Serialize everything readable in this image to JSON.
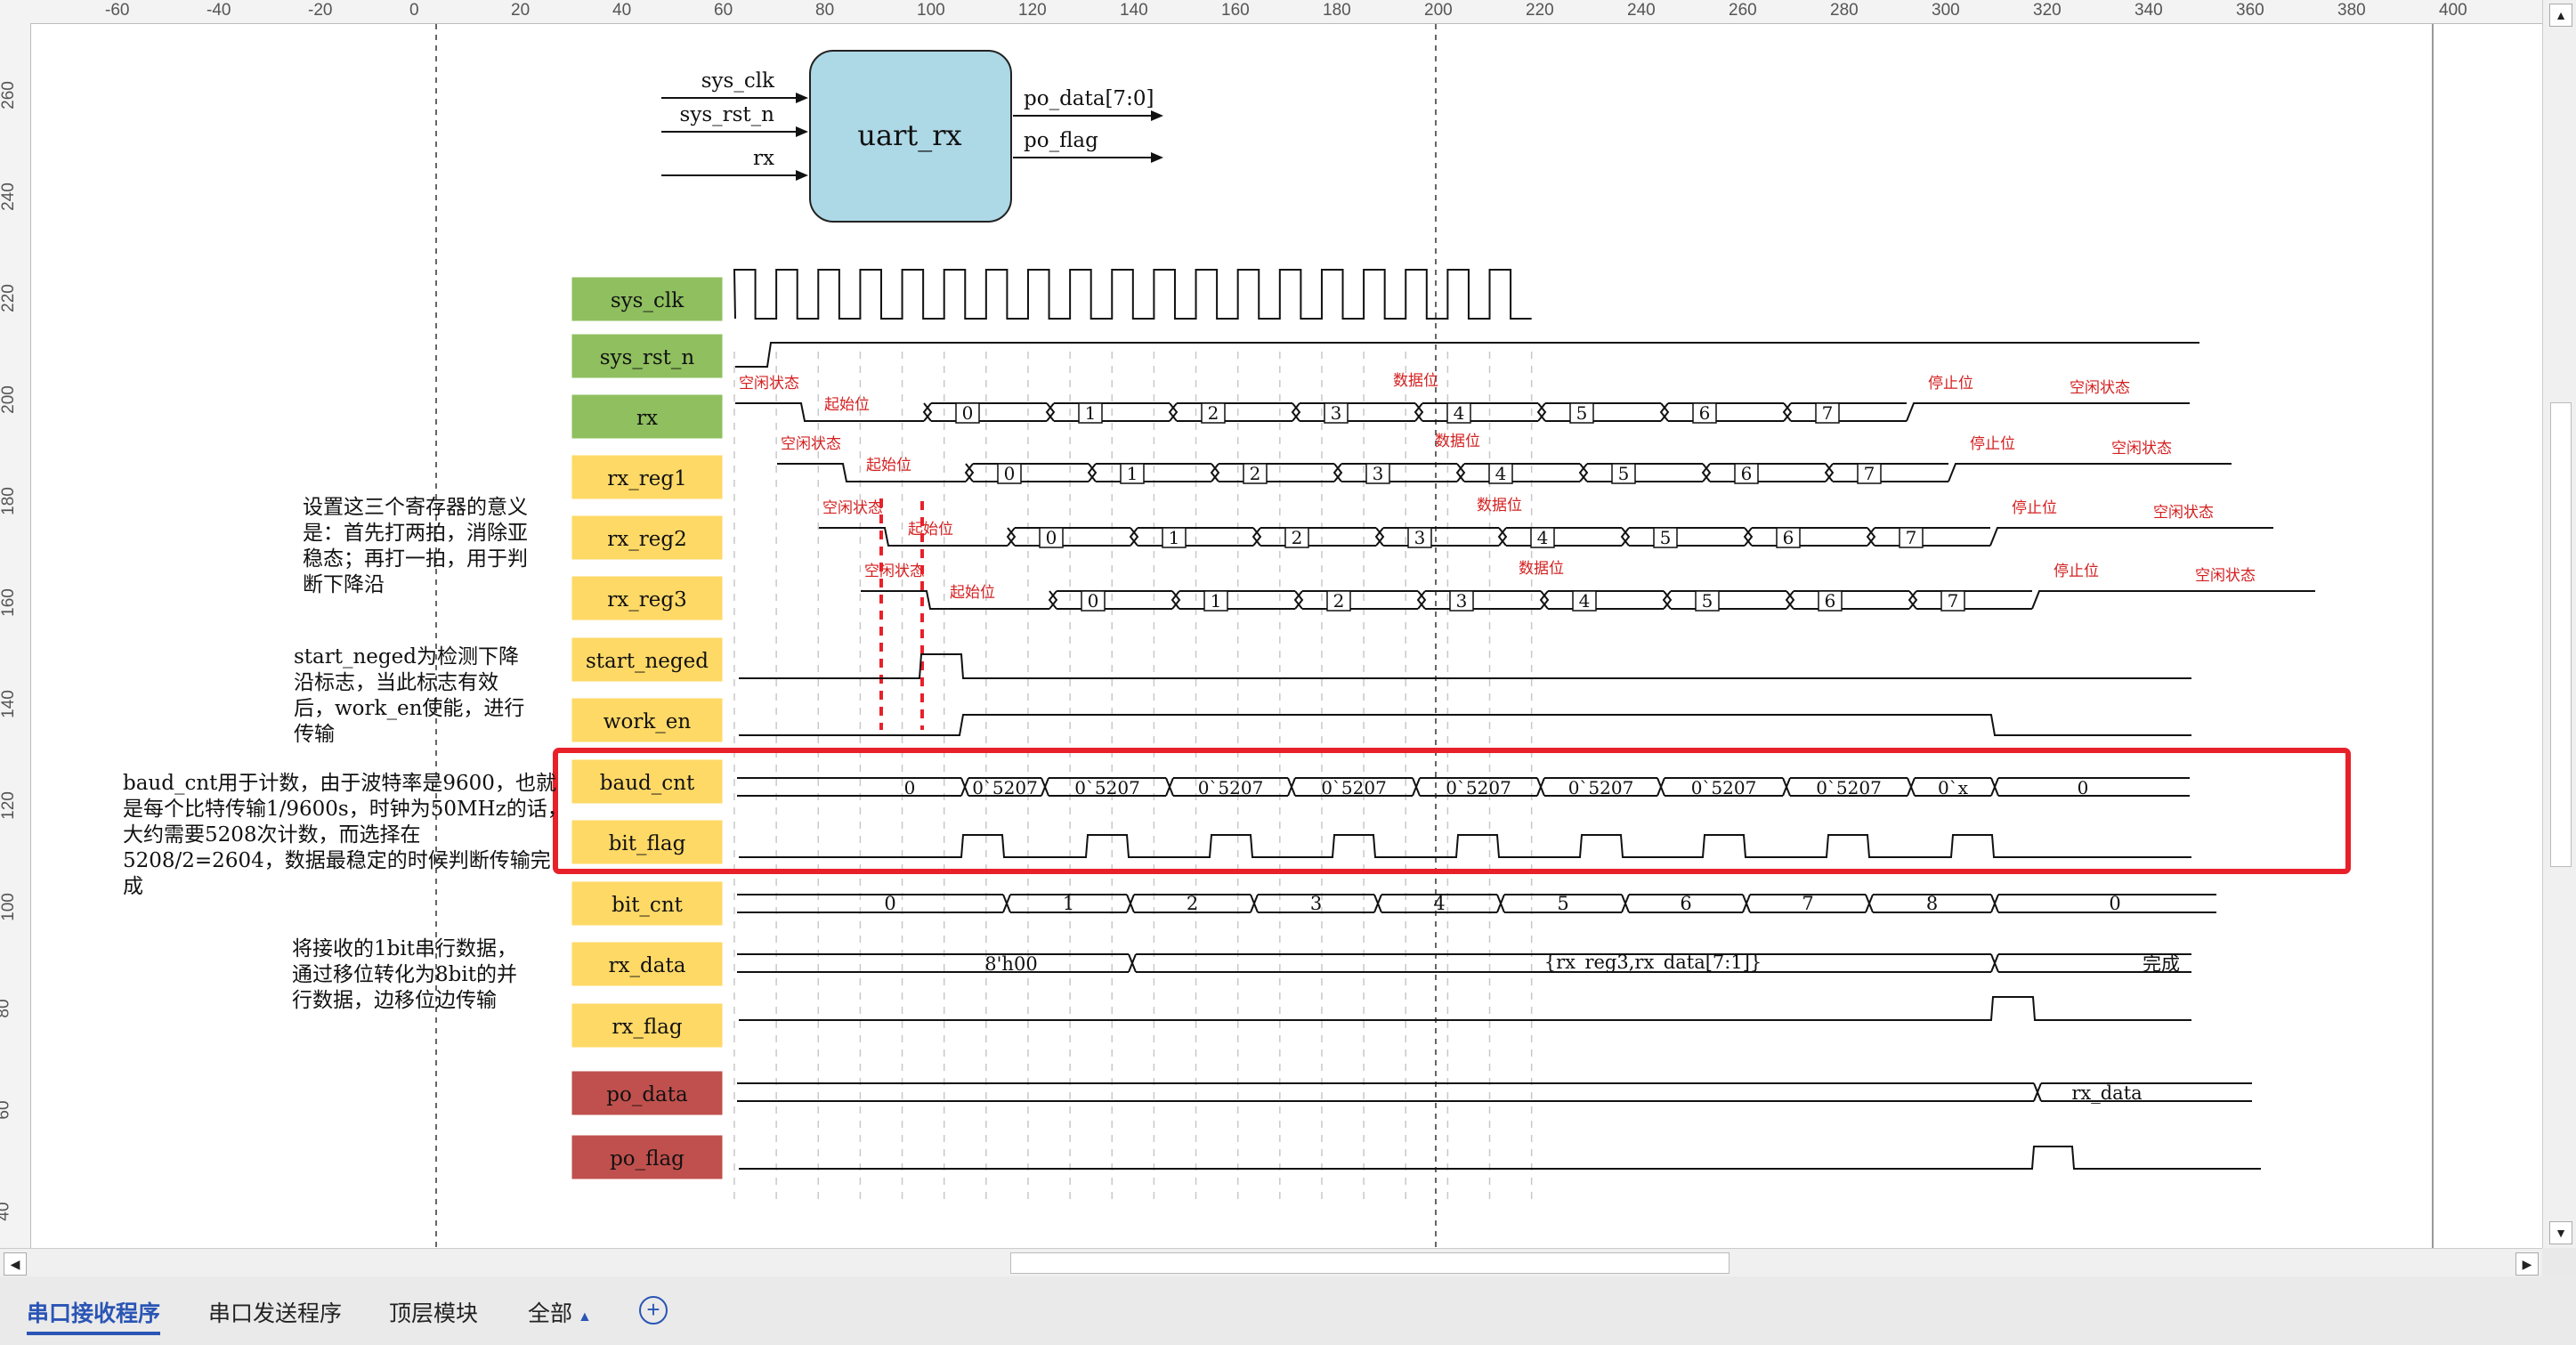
{
  "ruler_top": [
    "-60",
    "-40",
    "-20",
    "0",
    "20",
    "40",
    "60",
    "80",
    "100",
    "120",
    "140",
    "160",
    "180",
    "200",
    "220",
    "240",
    "260",
    "280",
    "300",
    "320",
    "340",
    "360",
    "380",
    "400"
  ],
  "ruler_left": [
    "260",
    "240",
    "220",
    "200",
    "180",
    "160",
    "140",
    "120",
    "100",
    "80",
    "60",
    "40"
  ],
  "module": {
    "name": "uart_rx",
    "inputs": [
      "sys_clk",
      "sys_rst_n",
      "rx"
    ],
    "outputs": [
      "po_data[7:0]",
      "po_flag"
    ]
  },
  "signals": [
    {
      "name": "sys_clk",
      "color": "#8fbf5f"
    },
    {
      "name": "sys_rst_n",
      "color": "#8fbf5f"
    },
    {
      "name": "rx",
      "color": "#8fbf5f"
    },
    {
      "name": "rx_reg1",
      "color": "#ffd966"
    },
    {
      "name": "rx_reg2",
      "color": "#ffd966"
    },
    {
      "name": "rx_reg3",
      "color": "#ffd966"
    },
    {
      "name": "start_neged",
      "color": "#ffd966"
    },
    {
      "name": "work_en",
      "color": "#ffd966"
    },
    {
      "name": "baud_cnt",
      "color": "#ffd966"
    },
    {
      "name": "bit_flag",
      "color": "#ffd966"
    },
    {
      "name": "bit_cnt",
      "color": "#ffd966"
    },
    {
      "name": "rx_data",
      "color": "#ffd966"
    },
    {
      "name": "rx_flag",
      "color": "#ffd966"
    },
    {
      "name": "po_data",
      "color": "#c0504d"
    },
    {
      "name": "po_flag",
      "color": "#c0504d"
    }
  ],
  "stage_labels": {
    "idle": "空闲状态",
    "start": "起始位",
    "data": "数据位",
    "stop": "停止位"
  },
  "data_bits": [
    "0",
    "1",
    "2",
    "3",
    "4",
    "5",
    "6",
    "7"
  ],
  "baud_values": {
    "first": "0",
    "count": "0`5207",
    "last": "0`x",
    "end": "0"
  },
  "bit_cnt_values": [
    "0",
    "1",
    "2",
    "3",
    "4",
    "5",
    "6",
    "7",
    "8",
    "0"
  ],
  "rx_data_values": {
    "init": "8'h00",
    "shift": "{rx_reg3,rx_data[7:1]}",
    "done": "完成"
  },
  "po_data_value": "rx_data",
  "annotations": {
    "reg": [
      "设置这三个寄存器的意义",
      "是：首先打两拍，消除亚",
      "稳态；再打一拍，用于判",
      "断下降沿"
    ],
    "neged": [
      "start_neged为检测下降",
      "沿标志，当此标志有效",
      "后，work_en使能，进行",
      "传输"
    ],
    "baud": [
      "baud_cnt用于计数，由于波特率是9600，也就",
      "是每个比特传输1/9600s，时钟为50MHz的话，",
      "大约需要5208次计数，而选择在",
      "5208/2=2604，数据最稳定的时候判断传输完",
      "成"
    ],
    "rxdata": [
      "将接收的1bit串行数据，",
      "通过移位转化为8bit的并",
      "行数据，边移位边传输"
    ]
  },
  "colors": {
    "highlight": "#e8202a",
    "module_fill": "#add8e6",
    "accent": "#2a55b5"
  },
  "tabs": [
    {
      "label": "串口接收程序",
      "active": true
    },
    {
      "label": "串口发送程序",
      "active": false
    },
    {
      "label": "顶层模块",
      "active": false
    },
    {
      "label": "全部",
      "active": false
    }
  ]
}
